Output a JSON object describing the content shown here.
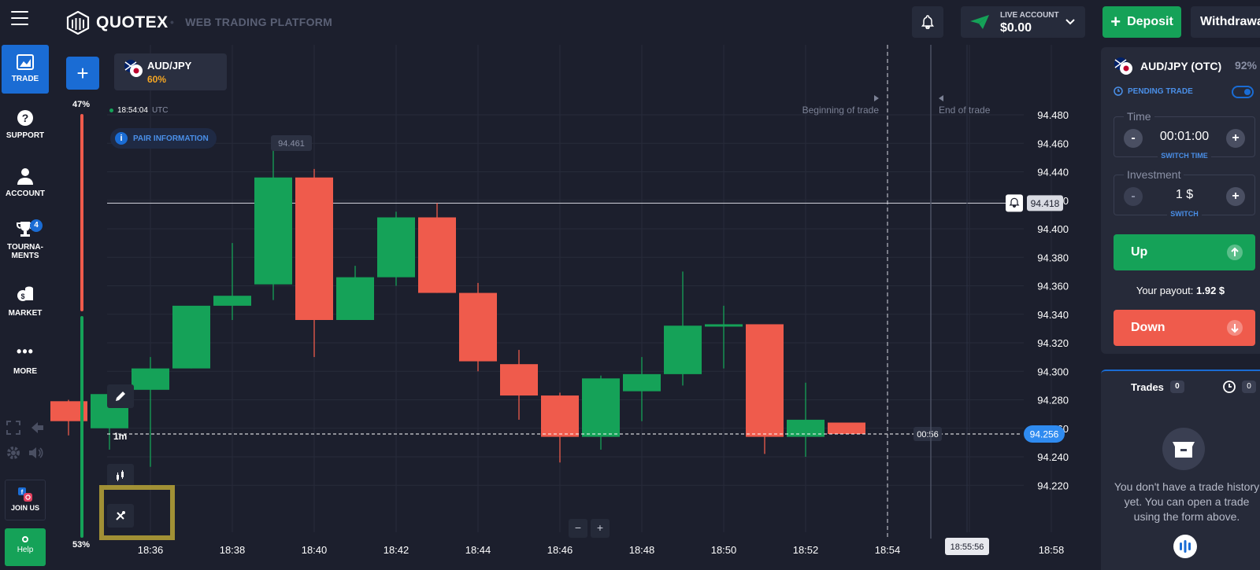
{
  "header": {
    "logo_text": "QUOTEX",
    "dot": "•",
    "tagline": "WEB TRADING PLATFORM",
    "account_label": "LIVE ACCOUNT",
    "balance": "$0.00",
    "deposit_label": "Deposit",
    "withdrawal_label": "Withdrawal"
  },
  "nav": {
    "items": [
      {
        "label": "TRADE"
      },
      {
        "label": "SUPPORT"
      },
      {
        "label": "ACCOUNT"
      },
      {
        "label": "TOURNA-",
        "label2": "MENTS",
        "badge": "4"
      },
      {
        "label": "MARKET"
      },
      {
        "label": "MORE"
      }
    ],
    "join_us": "JOIN US",
    "help": "Help"
  },
  "chart_header": {
    "add_symbol": "+",
    "asset": "AUD/JPY",
    "asset_pct": "60%",
    "server_time": "18:54:04",
    "tz": "UTC",
    "pair_info": "PAIR INFORMATION",
    "sentiment_up": "47%",
    "sentiment_down": "53%",
    "sentiment_up_fraction": 0.47,
    "timeframe": "1m",
    "beginning_label": "Beginning of trade",
    "end_label": "End of trade",
    "max_label": "94.461",
    "alert_price": "94.418",
    "current_price": "94.256",
    "countdown": "00:56",
    "expiry_time": "18:55:56",
    "zoom_minus": "−",
    "zoom_plus": "+"
  },
  "chart_data": {
    "type": "candlestick",
    "x_ticks": [
      "18:36",
      "18:38",
      "18:40",
      "18:42",
      "18:44",
      "18:46",
      "18:48",
      "18:50",
      "18:52",
      "18:54",
      "18:56",
      "18:58"
    ],
    "y_ticks": [
      "94.480",
      "94.460",
      "94.440",
      "94.420",
      "94.400",
      "94.380",
      "94.360",
      "94.340",
      "94.320",
      "94.300",
      "94.280",
      "94.260",
      "94.240",
      "94.220"
    ],
    "ylim": [
      94.2,
      94.49
    ],
    "candles": [
      {
        "t": "18:34",
        "o": 94.279,
        "h": 94.28,
        "l": 94.255,
        "c": 94.265
      },
      {
        "t": "18:35",
        "o": 94.26,
        "h": 94.29,
        "l": 94.245,
        "c": 94.284
      },
      {
        "t": "18:36",
        "o": 94.287,
        "h": 94.31,
        "l": 94.233,
        "c": 94.302
      },
      {
        "t": "18:37",
        "o": 94.302,
        "h": 94.34,
        "l": 94.302,
        "c": 94.346
      },
      {
        "t": "18:38",
        "o": 94.346,
        "h": 94.39,
        "l": 94.336,
        "c": 94.353
      },
      {
        "t": "18:39",
        "o": 94.361,
        "h": 94.455,
        "l": 94.35,
        "c": 94.436
      },
      {
        "t": "18:40",
        "o": 94.436,
        "h": 94.442,
        "l": 94.31,
        "c": 94.336
      },
      {
        "t": "18:41",
        "o": 94.336,
        "h": 94.374,
        "l": 94.336,
        "c": 94.366
      },
      {
        "t": "18:42",
        "o": 94.366,
        "h": 94.412,
        "l": 94.36,
        "c": 94.408
      },
      {
        "t": "18:43",
        "o": 94.408,
        "h": 94.418,
        "l": 94.355,
        "c": 94.355
      },
      {
        "t": "18:44",
        "o": 94.355,
        "h": 94.362,
        "l": 94.3,
        "c": 94.307
      },
      {
        "t": "18:45",
        "o": 94.305,
        "h": 94.315,
        "l": 94.266,
        "c": 94.283
      },
      {
        "t": "18:46",
        "o": 94.283,
        "h": 94.285,
        "l": 94.236,
        "c": 94.254
      },
      {
        "t": "18:47",
        "o": 94.254,
        "h": 94.297,
        "l": 94.245,
        "c": 94.295
      },
      {
        "t": "18:48",
        "o": 94.286,
        "h": 94.31,
        "l": 94.265,
        "c": 94.298
      },
      {
        "t": "18:49",
        "o": 94.298,
        "h": 94.37,
        "l": 94.29,
        "c": 94.332
      },
      {
        "t": "18:50",
        "o": 94.332,
        "h": 94.346,
        "l": 94.302,
        "c": 94.333
      },
      {
        "t": "18:51",
        "o": 94.333,
        "h": 94.333,
        "l": 94.242,
        "c": 94.254
      },
      {
        "t": "18:52",
        "o": 94.254,
        "h": 94.292,
        "l": 94.24,
        "c": 94.266
      },
      {
        "t": "18:53",
        "o": 94.264,
        "h": 94.264,
        "l": 94.256,
        "c": 94.256
      }
    ],
    "current_price": 94.256,
    "alert_price": 94.418
  },
  "panel": {
    "asset": "AUD/JPY (OTC)",
    "pct": "92%",
    "pending": "PENDING TRADE",
    "time_label": "Time",
    "time_value": "00:01:00",
    "switch_time": "SWITCH TIME",
    "investment_label": "Investment",
    "investment_value": "1 $",
    "switch": "SWITCH",
    "minus": "-",
    "plus": "+",
    "up": "Up",
    "payout_label": "Your payout:",
    "payout_value": "1.92 $",
    "down": "Down"
  },
  "trades": {
    "tab_trades": "Trades",
    "trades_count": "0",
    "history_count": "0",
    "empty": "You don't have a trade history yet. You can open a trade using the form above."
  },
  "colors": {
    "bg": "#1c1f2d",
    "green": "#15a258",
    "red": "#ef5b4c",
    "blue": "#1a6cd4",
    "accent_orange": "#f5a623"
  }
}
